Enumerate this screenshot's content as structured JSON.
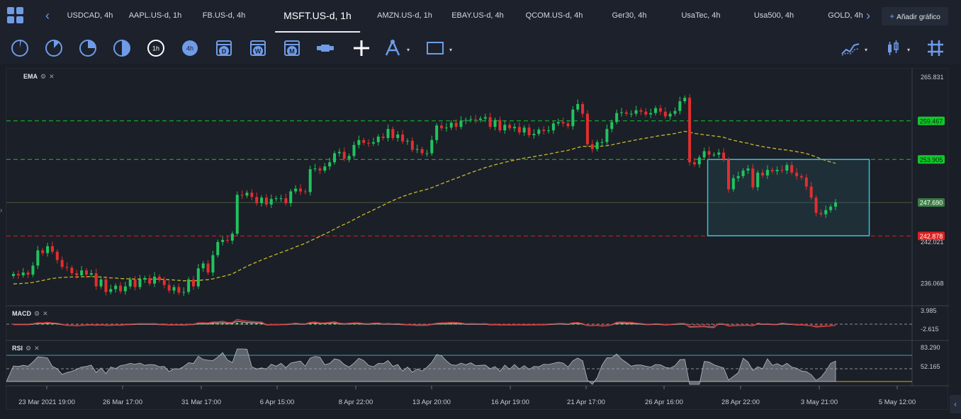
{
  "tabs": [
    {
      "label": "USDCAD, 4h"
    },
    {
      "label": "AAPL.US-d, 1h"
    },
    {
      "label": "FB.US-d, 4h"
    },
    {
      "label": "MSFT.US-d, 1h",
      "active": true
    },
    {
      "label": "AMZN.US-d, 1h"
    },
    {
      "label": "EBAY.US-d, 4h"
    },
    {
      "label": "QCOM.US-d, 4h"
    },
    {
      "label": "Ger30, 4h"
    },
    {
      "label": "UsaTec, 4h"
    },
    {
      "label": "Usa500, 4h"
    },
    {
      "label": "GOLD, 4h"
    }
  ],
  "add_chart_label": "Añadir gráfico",
  "toolbar": {
    "timeframes": [
      "1m",
      "5m",
      "15m",
      "30m",
      "1h",
      "4h",
      "D",
      "W",
      "M"
    ]
  },
  "indicators": {
    "ema": "EMA",
    "macd": "MACD",
    "rsi": "RSI"
  },
  "colors": {
    "bull": "#1fc45e",
    "bear": "#e02f2f",
    "ema": "#c9b92a",
    "accent": "#6f9ce8",
    "green_level": "#12c72b",
    "red_level": "#dd1f1f",
    "current_price": "#3a7d44"
  },
  "chart_data": {
    "type": "candlestick",
    "symbol": "MSFT.US-d, 1h",
    "y_ticks": [
      "265.831",
      "242.021",
      "236.068"
    ],
    "ylim": [
      232.5,
      267.0
    ],
    "x_ticks": [
      "23 Mar 2021 19:00",
      "26 Mar 17:00",
      "31 Mar 17:00",
      "6 Apr 15:00",
      "8 Apr 22:00",
      "13 Apr 20:00",
      "16 Apr 19:00",
      "21 Apr 17:00",
      "26 Apr 16:00",
      "28 Apr 22:00",
      "3 May 21:00",
      "5 May 12:00"
    ],
    "price_levels": [
      {
        "label": "259.467",
        "price": 259.467,
        "style": "green-dashed"
      },
      {
        "label": "253.905",
        "price": 253.905,
        "style": "green-dashed"
      },
      {
        "label": "247.690",
        "price": 247.69,
        "style": "current"
      },
      {
        "label": "242.878",
        "price": 242.878,
        "style": "red-dashed"
      }
    ],
    "rectangle": {
      "price_top": 253.905,
      "price_bottom": 242.9
    },
    "closes": [
      237.4,
      237.2,
      237.6,
      237.3,
      238.6,
      240.8,
      240.4,
      241.4,
      240.6,
      239.4,
      238.4,
      238.3,
      237.5,
      237.2,
      237.9,
      237.3,
      237.5,
      235.6,
      236.6,
      234.8,
      235.2,
      235.7,
      234.9,
      235.6,
      236.6,
      235.5,
      236.6,
      236.8,
      236.0,
      237.0,
      236.5,
      235.8,
      235.0,
      235.5,
      234.7,
      234.8,
      236.6,
      235.6,
      238.2,
      238.9,
      237.6,
      240.1,
      242.0,
      242.3,
      242.2,
      243.2,
      248.8,
      248.7,
      249.1,
      248.5,
      247.6,
      248.4,
      247.4,
      248.2,
      248.3,
      248.3,
      247.6,
      249.3,
      249.7,
      249.3,
      249.2,
      252.5,
      252.6,
      252.3,
      252.9,
      253.5,
      254.8,
      255.0,
      254.0,
      254.4,
      256.0,
      256.7,
      256.3,
      256.2,
      256.4,
      257.2,
      257.0,
      258.3,
      257.0,
      257.5,
      256.5,
      256.6,
      255.3,
      255.4,
      254.8,
      254.8,
      256.7,
      258.8,
      258.4,
      258.5,
      259.2,
      258.6,
      259.5,
      259.6,
      259.7,
      259.6,
      259.8,
      260.0,
      258.6,
      259.6,
      258.1,
      258.9,
      258.4,
      258.6,
      257.8,
      258.5,
      257.4,
      257.6,
      258.2,
      258.0,
      258.1,
      259.1,
      259.3,
      259.1,
      258.7,
      261.1,
      261.9,
      260.5,
      256.1,
      255.4,
      256.4,
      256.4,
      258.3,
      259.3,
      260.6,
      260.7,
      260.5,
      260.5,
      261.0,
      260.8,
      260.4,
      260.6,
      261.3,
      260.8,
      260.1,
      260.5,
      260.9,
      262.3,
      262.8,
      253.5,
      253.2,
      254.2,
      255.1,
      254.6,
      254.6,
      254.9,
      253.9,
      249.6,
      251.2,
      251.5,
      252.3,
      252.6,
      249.9,
      252.0,
      251.6,
      252.4,
      252.2,
      252.4,
      252.3,
      253.1,
      252.0,
      251.5,
      251.3,
      250.0,
      248.4,
      246.2,
      246.0,
      246.6,
      247.1,
      247.7
    ],
    "ema_series": "dashed",
    "macd_ticks": [
      "3.985",
      "-2.615"
    ],
    "rsi_ticks": [
      "83.290",
      "52.165"
    ]
  }
}
